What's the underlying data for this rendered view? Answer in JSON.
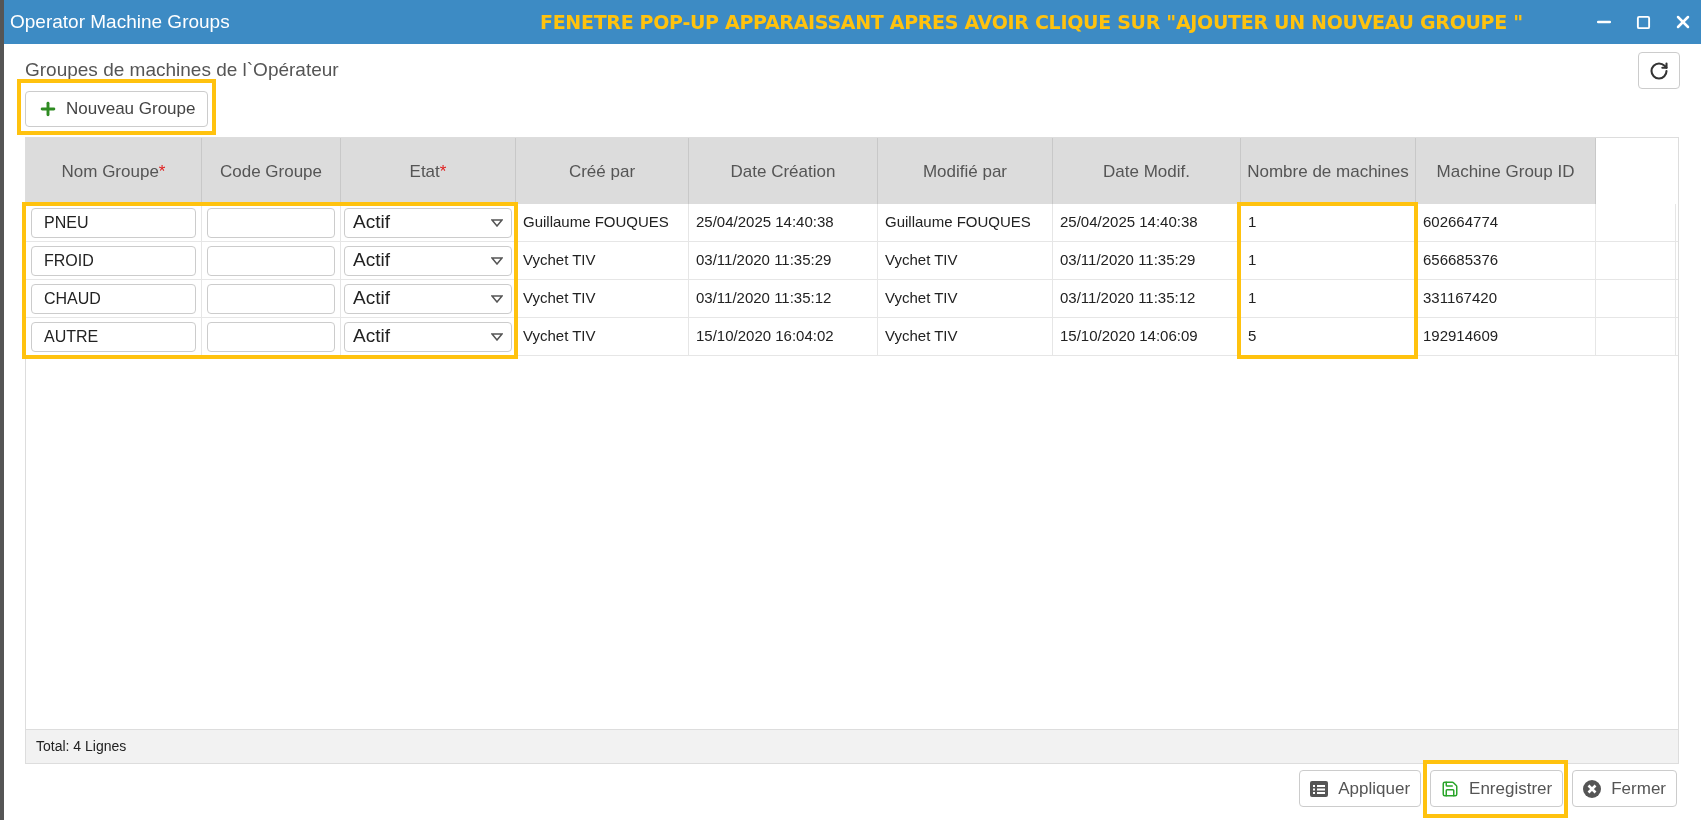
{
  "window": {
    "title": "Operator Machine Groups",
    "annotation": "FENETRE POP-UP APPARAISSANT APRES AVOIR CLIQUE SUR \"AJOUTER UN NOUVEAU GROUPE \""
  },
  "heading": "Groupes de machines de l`Opérateur",
  "new_button": {
    "label": "Nouveau Groupe",
    "highlighted": true
  },
  "table": {
    "columns": [
      {
        "label": "Nom Groupe",
        "required_mark": "*",
        "highlighted": true
      },
      {
        "label": "Code Groupe",
        "highlighted": true
      },
      {
        "label": "Etat",
        "required_mark": "*",
        "highlighted": true
      },
      {
        "label": "Créé par",
        "highlighted": false
      },
      {
        "label": "Date Création",
        "highlighted": false
      },
      {
        "label": "Modifié par",
        "highlighted": false
      },
      {
        "label": "Date Modif.",
        "highlighted": false
      },
      {
        "label": "Nombre de machines",
        "highlighted": true
      },
      {
        "label": "Machine Group ID",
        "highlighted": false
      }
    ],
    "rows": [
      {
        "name": "PNEU",
        "state": "Actif",
        "created_by": "Guillaume FOUQUES",
        "created": "25/04/2025 14:40:38",
        "modified_by": "Guillaume FOUQUES",
        "modified": "25/04/2025 14:40:38",
        "machines": "1",
        "id": "602664774"
      },
      {
        "name": "FROID",
        "state": "Actif",
        "created_by": "Vychet TIV",
        "created": "03/11/2020 11:35:29",
        "modified_by": "Vychet TIV",
        "modified": "03/11/2020 11:35:29",
        "machines": "1",
        "id": "656685376"
      },
      {
        "name": "CHAUD",
        "state": "Actif",
        "created_by": "Vychet TIV",
        "created": "03/11/2020 11:35:12",
        "modified_by": "Vychet TIV",
        "modified": "03/11/2020 11:35:12",
        "machines": "1",
        "id": "331167420"
      },
      {
        "name": "AUTRE",
        "state": "Actif",
        "created_by": "Vychet TIV",
        "created": "15/10/2020 16:04:02",
        "modified_by": "Vychet TIV",
        "modified": "15/10/2020 14:06:09",
        "machines": "5",
        "id": "192914609"
      }
    ],
    "footer": "Total: 4 Lignes"
  },
  "buttons": [
    {
      "kind": "apply",
      "label": "Appliquer",
      "highlighted": false
    },
    {
      "kind": "save",
      "label": "Enregistrer",
      "highlighted": true
    },
    {
      "kind": "close",
      "label": "Fermer",
      "highlighted": false
    }
  ]
}
